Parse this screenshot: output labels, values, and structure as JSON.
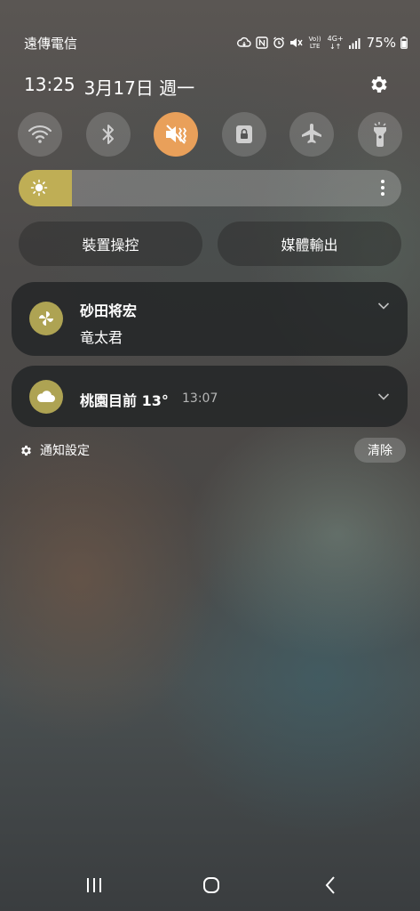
{
  "status_bar": {
    "carrier": "遠傳電信",
    "battery_percent": "75%",
    "icons": [
      "sync-icon",
      "nfc-icon",
      "alarm-icon",
      "mute-icon",
      "volte-icon",
      "4g-plus-icon",
      "signal-icon",
      "battery-icon"
    ],
    "volte_text": "Vo)) LTE",
    "network_text": "4G+"
  },
  "header": {
    "time": "13:25",
    "date": "3月17日 週一"
  },
  "quick_settings": [
    {
      "name": "wifi",
      "icon": "wifi-icon",
      "active": false
    },
    {
      "name": "bluetooth",
      "icon": "bluetooth-icon",
      "active": false
    },
    {
      "name": "sound-mute",
      "icon": "mute-icon",
      "active": true
    },
    {
      "name": "rotation-lock",
      "icon": "lock-icon",
      "active": false
    },
    {
      "name": "airplane",
      "icon": "airplane-icon",
      "active": false
    },
    {
      "name": "flashlight",
      "icon": "flashlight-icon",
      "active": false
    }
  ],
  "brightness": {
    "level": 0.14
  },
  "buttons": {
    "device_control": "裝置操控",
    "media_output": "媒體輸出"
  },
  "notifications": [
    {
      "title": "砂田将宏",
      "body": "竜太君"
    },
    {
      "title": "桃園目前 13°",
      "time": "13:07"
    }
  ],
  "footer": {
    "notification_settings": "通知設定",
    "clear": "清除"
  },
  "colors": {
    "accent_active": "#e9a05a",
    "brightness_fill": "#bfae55",
    "app_icon": "#aea353"
  }
}
